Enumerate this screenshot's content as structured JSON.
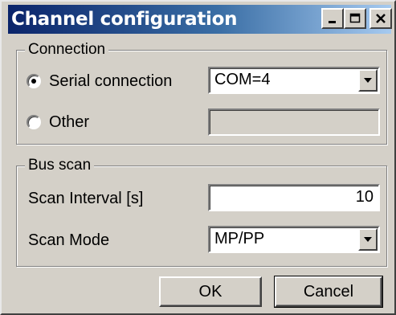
{
  "window": {
    "title": "Channel configuration",
    "title_bar_colors": [
      "#0a246a",
      "#a6caf0"
    ],
    "buttons": {
      "minimize": "minimize-icon",
      "maximize": "maximize-icon",
      "close": "close-icon"
    }
  },
  "connection": {
    "legend": "Connection",
    "serial_label": "Serial connection",
    "serial_selected": true,
    "port_value": "COM=4",
    "other_label": "Other",
    "other_selected": false,
    "other_value": ""
  },
  "bus_scan": {
    "legend": "Bus scan",
    "interval_label": "Scan Interval [s]",
    "interval_value": "10",
    "mode_label": "Scan Mode",
    "mode_value": "MP/PP"
  },
  "footer": {
    "ok_label": "OK",
    "cancel_label": "Cancel"
  }
}
